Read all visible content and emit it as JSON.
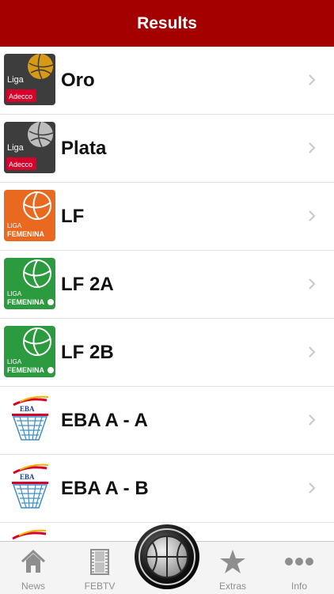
{
  "header": {
    "title": "Results"
  },
  "leagues": [
    {
      "label": "Oro",
      "logo": "liga-adecco-oro-logo",
      "logo_word": "Liga",
      "logo_sponsor": "Adecco",
      "ball_color": "#d89a14"
    },
    {
      "label": "Plata",
      "logo": "liga-adecco-plata-logo",
      "logo_word": "Liga",
      "logo_sponsor": "Adecco",
      "ball_color": "#bdbdbd"
    },
    {
      "label": "LF",
      "logo": "liga-femenina-logo",
      "logo_word": "LIGA",
      "logo_sponsor": "FEMENINA",
      "bg_color": "#e8691f"
    },
    {
      "label": "LF 2A",
      "logo": "liga-femenina-2-logo",
      "logo_word": "LIGA",
      "logo_sponsor": "FEMENINA",
      "bg_color": "#2c9b3f"
    },
    {
      "label": "LF 2B",
      "logo": "liga-femenina-2-logo",
      "logo_word": "LIGA",
      "logo_sponsor": "FEMENINA",
      "bg_color": "#2c9b3f"
    },
    {
      "label": "EBA A - A",
      "logo": "liga-eba-logo",
      "logo_word": "EBA"
    },
    {
      "label": "EBA A - B",
      "logo": "liga-eba-logo",
      "logo_word": "EBA"
    }
  ],
  "tabs": [
    {
      "label": "News",
      "icon": "house-icon"
    },
    {
      "label": "FEBTV",
      "icon": "film-icon"
    },
    {
      "label": "",
      "icon": "basketball-icon"
    },
    {
      "label": "Extras",
      "icon": "star-icon"
    },
    {
      "label": "Info",
      "icon": "more-dots-icon"
    }
  ],
  "colors": {
    "header": "#a50000",
    "tab_icon": "#8e8e8e"
  }
}
